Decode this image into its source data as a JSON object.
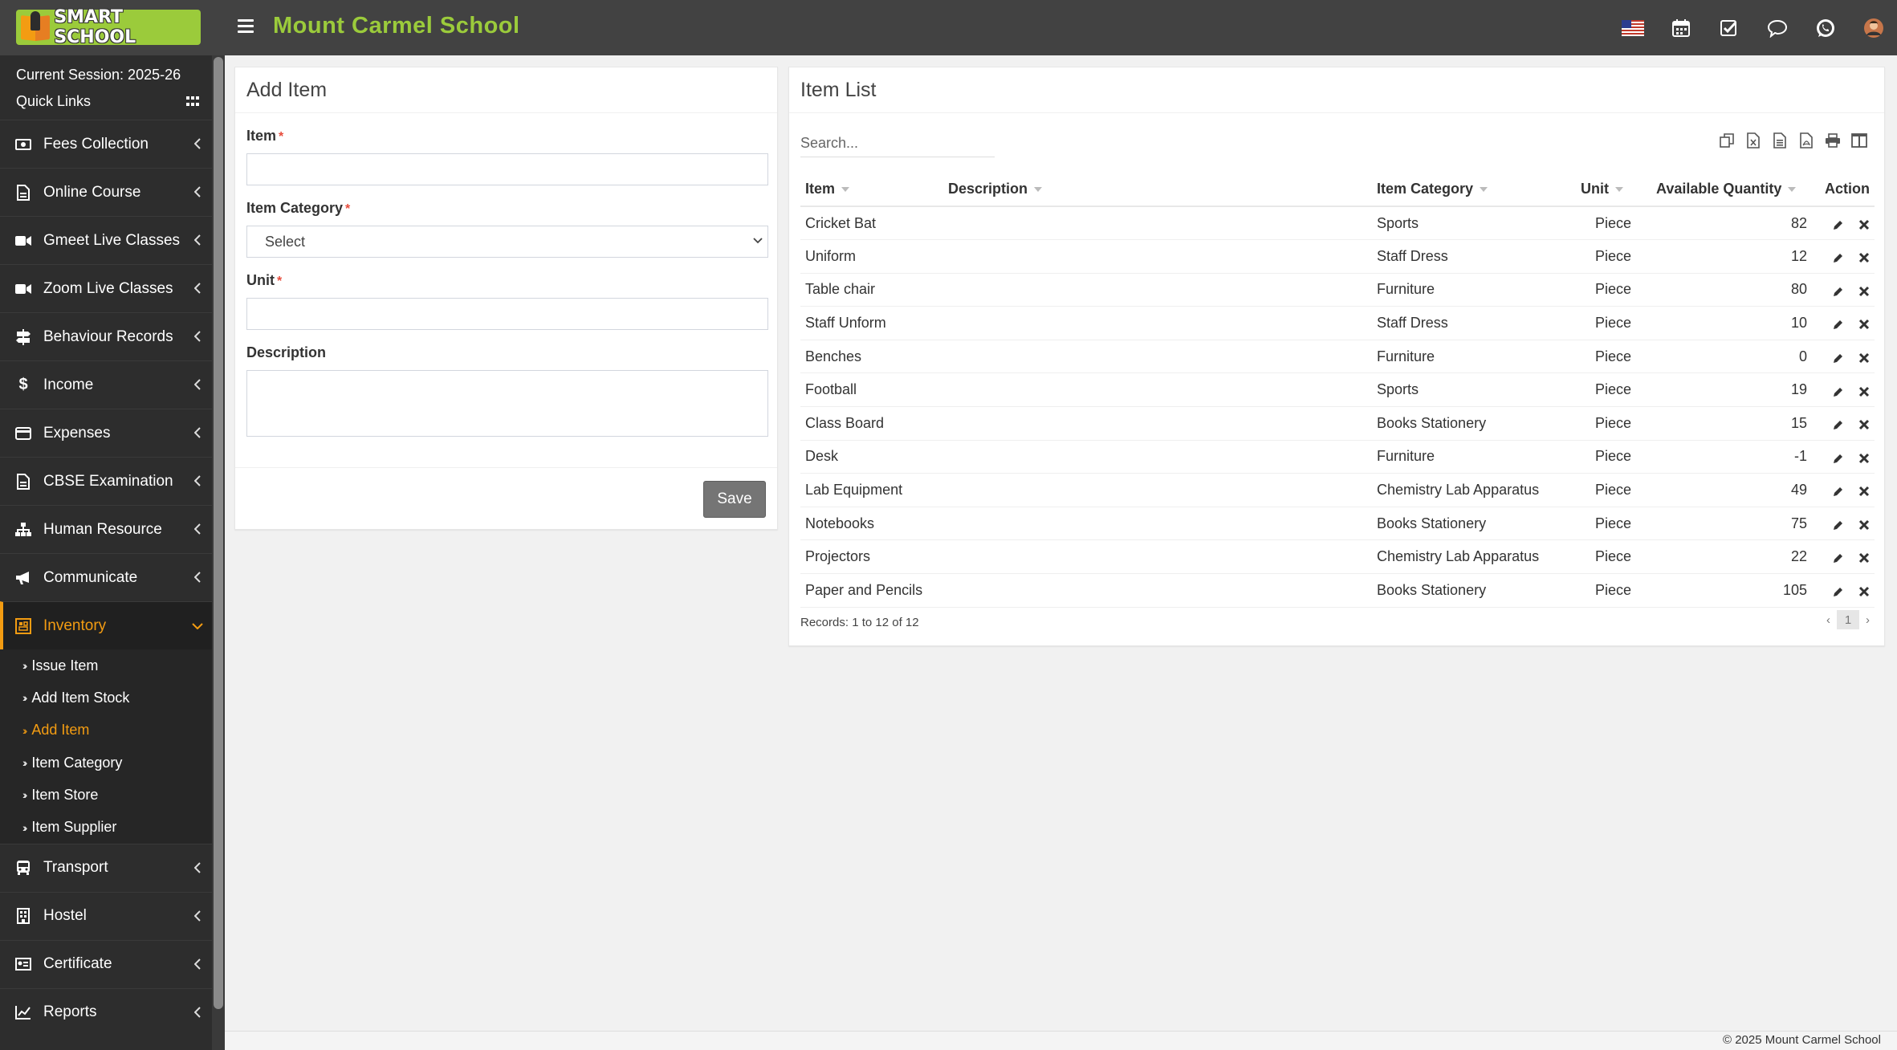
{
  "header": {
    "logo_text": "SMART SCHOOL",
    "school_name": "Mount Carmel School",
    "icons": [
      "flag-us-icon",
      "calendar-icon",
      "task-check-icon",
      "chat-icon",
      "whatsapp-icon",
      "user-avatar"
    ]
  },
  "sidebar": {
    "session": "Current Session: 2025-26",
    "quick_links": "Quick Links",
    "menu": [
      {
        "label": "Fees Collection",
        "icon": "money-icon"
      },
      {
        "label": "Online Course",
        "icon": "file-icon"
      },
      {
        "label": "Gmeet Live Classes",
        "icon": "video-icon"
      },
      {
        "label": "Zoom Live Classes",
        "icon": "video-icon"
      },
      {
        "label": "Behaviour Records",
        "icon": "signpost-icon"
      },
      {
        "label": "Income",
        "icon": "dollar-icon"
      },
      {
        "label": "Expenses",
        "icon": "credit-card-icon"
      },
      {
        "label": "CBSE Examination",
        "icon": "file-icon"
      },
      {
        "label": "Human Resource",
        "icon": "sitemap-icon"
      },
      {
        "label": "Communicate",
        "icon": "bullhorn-icon"
      },
      {
        "label": "Inventory",
        "icon": "inventory-icon"
      },
      {
        "label": "Transport",
        "icon": "bus-icon"
      },
      {
        "label": "Hostel",
        "icon": "building-icon"
      },
      {
        "label": "Certificate",
        "icon": "certificate-icon"
      },
      {
        "label": "Reports",
        "icon": "line-chart-icon"
      }
    ],
    "inventory_sub": [
      "Issue Item",
      "Add Item Stock",
      "Add Item",
      "Item Category",
      "Item Store",
      "Item Supplier"
    ]
  },
  "form": {
    "title": "Add Item",
    "item_label": "Item",
    "category_label": "Item Category",
    "category_value": "Select",
    "unit_label": "Unit",
    "description_label": "Description",
    "required_mark": "*",
    "save_label": "Save"
  },
  "list": {
    "title": "Item List",
    "search_placeholder": "Search...",
    "columns": [
      "Item",
      "Description",
      "Item Category",
      "Unit",
      "Available Quantity",
      "Action"
    ],
    "rows": [
      {
        "item": "Cricket Bat",
        "description": "",
        "category": "Sports",
        "unit": "Piece",
        "qty": "82"
      },
      {
        "item": "Uniform",
        "description": "",
        "category": "Staff Dress",
        "unit": "Piece",
        "qty": "12"
      },
      {
        "item": "Table chair",
        "description": "",
        "category": "Furniture",
        "unit": "Piece",
        "qty": "80"
      },
      {
        "item": "Staff Unform",
        "description": "",
        "category": "Staff Dress",
        "unit": "Piece",
        "qty": "10"
      },
      {
        "item": "Benches",
        "description": "",
        "category": "Furniture",
        "unit": "Piece",
        "qty": "0"
      },
      {
        "item": "Football",
        "description": "",
        "category": "Sports",
        "unit": "Piece",
        "qty": "19"
      },
      {
        "item": "Class Board",
        "description": "",
        "category": "Books Stationery",
        "unit": "Piece",
        "qty": "15"
      },
      {
        "item": "Desk",
        "description": "",
        "category": "Furniture",
        "unit": "Piece",
        "qty": "-1"
      },
      {
        "item": "Lab Equipment",
        "description": "",
        "category": "Chemistry Lab Apparatus",
        "unit": "Piece",
        "qty": "49"
      },
      {
        "item": "Notebooks",
        "description": "",
        "category": "Books Stationery",
        "unit": "Piece",
        "qty": "75"
      },
      {
        "item": "Projectors",
        "description": "",
        "category": "Chemistry Lab Apparatus",
        "unit": "Piece",
        "qty": "22"
      },
      {
        "item": "Paper and Pencils",
        "description": "",
        "category": "Books Stationery",
        "unit": "Piece",
        "qty": "105"
      }
    ],
    "records": "Records: 1 to 12 of 12",
    "page": "1",
    "prev": "‹",
    "next": "›"
  },
  "footer": {
    "copyright": "© 2025 Mount Carmel School"
  },
  "colors": {
    "topbar": "#424242",
    "brand_green": "#9bcb3b",
    "sidebar": "#2d2d2d",
    "active_orange": "#f39c12"
  }
}
